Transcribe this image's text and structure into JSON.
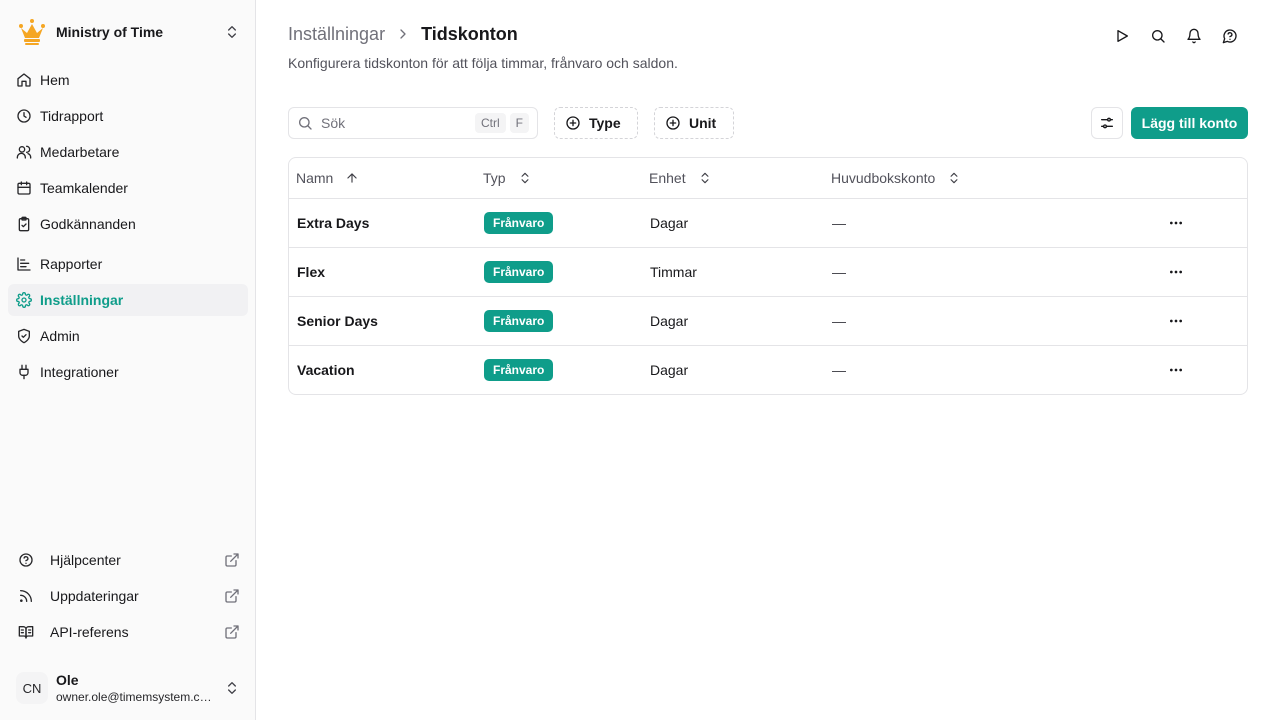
{
  "org": {
    "name": "Ministry of Time",
    "logo_icon": "crown-icon",
    "logo_color": "#f5a623"
  },
  "nav": {
    "items": [
      {
        "label": "Hem",
        "icon": "home-icon"
      },
      {
        "label": "Tidrapport",
        "icon": "clock-icon"
      },
      {
        "label": "Medarbetare",
        "icon": "users-icon"
      },
      {
        "label": "Teamkalender",
        "icon": "calendar-icon"
      },
      {
        "label": "Godkännanden",
        "icon": "clipboard-check-icon"
      },
      {
        "label": "Rapporter",
        "icon": "chart-icon"
      },
      {
        "label": "Inställningar",
        "icon": "gear-icon",
        "active": true
      },
      {
        "label": "Admin",
        "icon": "shield-check-icon"
      },
      {
        "label": "Integrationer",
        "icon": "plug-icon"
      }
    ],
    "footer": [
      {
        "label": "Hjälpcenter",
        "icon": "help-circle-icon"
      },
      {
        "label": "Uppdateringar",
        "icon": "rss-icon"
      },
      {
        "label": "API-referens",
        "icon": "book-open-icon"
      }
    ]
  },
  "user": {
    "initials": "CN",
    "name": "Ole",
    "email": "owner.ole@timemsystem.com"
  },
  "header": {
    "breadcrumb_parent": "Inställningar",
    "breadcrumb_current": "Tidskonton",
    "subtitle": "Konfigurera tidskonton för att följa timmar, frånvaro och saldon."
  },
  "toolbar": {
    "search_placeholder": "Sök",
    "shortcut_ctrl": "Ctrl",
    "shortcut_key": "F",
    "filter_type": "Type",
    "filter_unit": "Unit",
    "add_button": "Lägg till konto"
  },
  "table": {
    "columns": [
      "Namn",
      "Typ",
      "Enhet",
      "Huvudbokskonto"
    ],
    "rows": [
      {
        "name": "Extra Days",
        "type": "Frånvaro",
        "unit": "Dagar",
        "ledger": "—"
      },
      {
        "name": "Flex",
        "type": "Frånvaro",
        "unit": "Timmar",
        "ledger": "—"
      },
      {
        "name": "Senior Days",
        "type": "Frånvaro",
        "unit": "Dagar",
        "ledger": "—"
      },
      {
        "name": "Vacation",
        "type": "Frånvaro",
        "unit": "Dagar",
        "ledger": "—"
      }
    ]
  },
  "colors": {
    "accent": "#0f9d8a",
    "sidebar_bg": "#fafafa",
    "border": "#e4e4e7"
  }
}
